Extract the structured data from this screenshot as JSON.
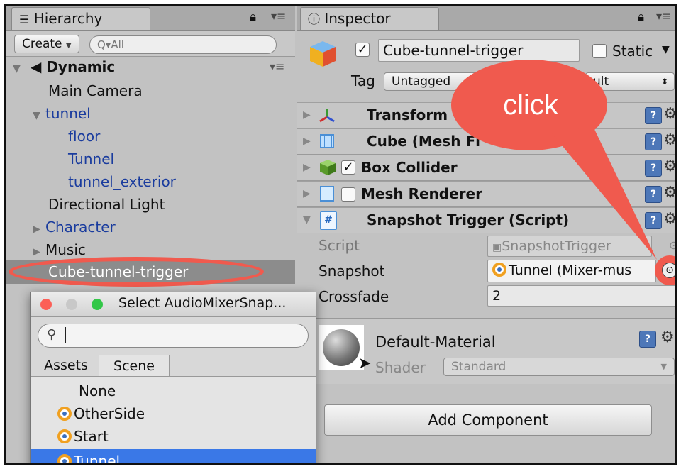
{
  "hierarchy": {
    "tab_label": "Hierarchy",
    "create_label": "Create",
    "search_placeholder": "Q▾All",
    "scene_name": "Dynamic",
    "items": [
      {
        "label": "Main Camera"
      },
      {
        "label": "tunnel"
      },
      {
        "label": "floor"
      },
      {
        "label": "Tunnel"
      },
      {
        "label": "tunnel_exterior"
      },
      {
        "label": "Directional Light"
      },
      {
        "label": "Character"
      },
      {
        "label": "Music"
      },
      {
        "label": "Cube-tunnel-trigger"
      }
    ]
  },
  "inspector": {
    "tab_label": "Inspector",
    "object_name": "Cube-tunnel-trigger",
    "static_label": "Static",
    "tag_label": "Tag",
    "tag_value": "Untagged",
    "layer_value": "ult",
    "components": [
      {
        "label": "Transform"
      },
      {
        "label": "Cube (Mesh Fi"
      },
      {
        "label": "Box Collider"
      },
      {
        "label": "Mesh Renderer"
      },
      {
        "label": "Snapshot Trigger (Script)"
      }
    ],
    "script_label": "Script",
    "script_value": "SnapshotTrigger",
    "snapshot_label": "Snapshot",
    "snapshot_value": "Tunnel (Mixer-mus",
    "crossfade_label": "Crossfade",
    "crossfade_value": "2",
    "material_name": "Default-Material",
    "shader_label": "Shader",
    "shader_value": "Standard",
    "add_component_label": "Add Component"
  },
  "callout": {
    "text": "click",
    "color": "#f05a4e"
  },
  "popup": {
    "title": "Select AudioMixerSnap...",
    "search_value": "",
    "tabs": [
      {
        "label": "Assets"
      },
      {
        "label": "Scene"
      }
    ],
    "items": [
      {
        "label": "None"
      },
      {
        "label": "OtherSide"
      },
      {
        "label": "Start"
      },
      {
        "label": "Tunnel"
      }
    ]
  },
  "colors": {
    "selection": "#3a78e7",
    "highlight_ring": "#f05a4e",
    "hierarchy_selected": "#8c8c8c"
  }
}
